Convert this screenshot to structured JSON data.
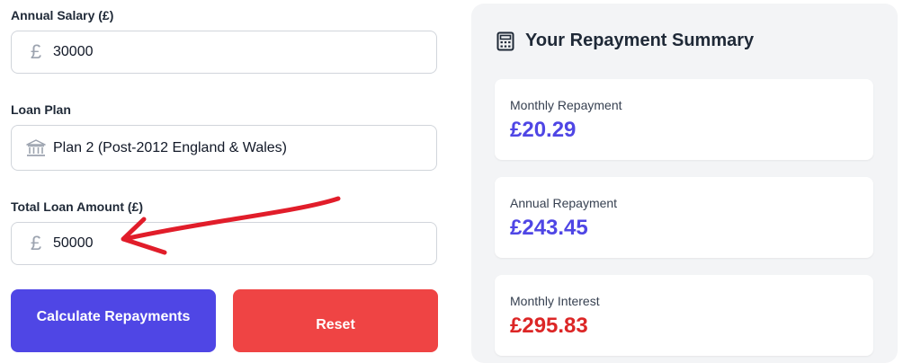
{
  "form": {
    "salary": {
      "label": "Annual Salary (£)",
      "icon": "pound-icon",
      "value": "30000"
    },
    "plan": {
      "label": "Loan Plan",
      "icon": "bank-icon",
      "value": "Plan 2 (Post-2012 England & Wales)"
    },
    "loan": {
      "label": "Total Loan Amount (£)",
      "icon": "pound-icon",
      "value": "50000"
    },
    "currency_symbol": "£"
  },
  "buttons": {
    "calculate": "Calculate Repayments",
    "reset": "Reset"
  },
  "summary": {
    "title": "Your Repayment Summary",
    "icon": "calculator-icon",
    "cards": [
      {
        "label": "Monthly Repayment",
        "value": "£20.29",
        "color": "#4f46e5"
      },
      {
        "label": "Annual Repayment",
        "value": "£243.45",
        "color": "#4f46e5"
      },
      {
        "label": "Monthly Interest",
        "value": "£295.83",
        "color": "#dc2626"
      }
    ]
  },
  "colors": {
    "primary": "#4f46e5",
    "danger": "#ef4444",
    "annotation": "#e11d2a"
  }
}
